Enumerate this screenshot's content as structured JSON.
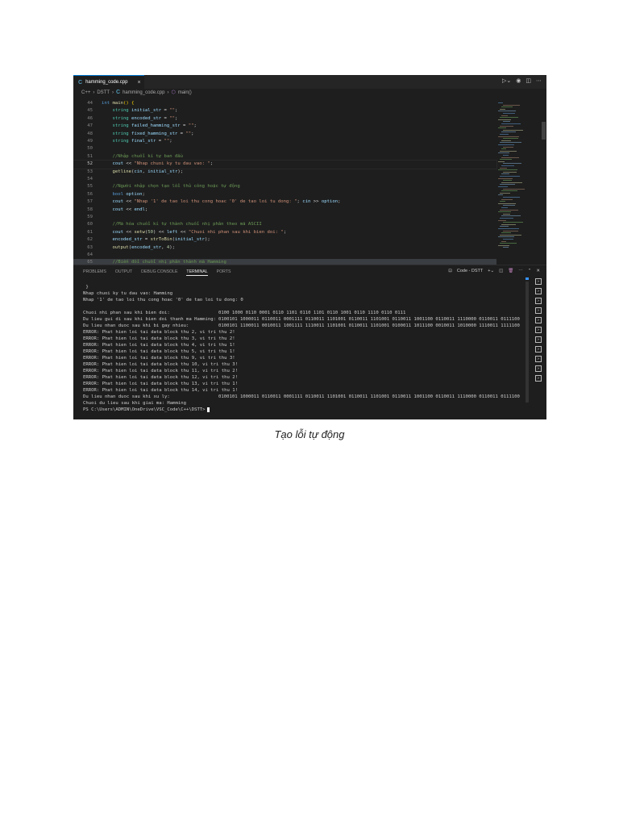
{
  "tab": {
    "icon": "C",
    "filename": "hamming_code.cpp",
    "close": "×"
  },
  "breadcrumb": [
    "C++",
    "DSTT",
    "hamming_code.cpp",
    "main()"
  ],
  "editor_lines": [
    {
      "num": "44",
      "tokens": [
        [
          "int ",
          "k"
        ],
        [
          "main",
          "f"
        ],
        [
          "() {",
          "b"
        ]
      ]
    },
    {
      "num": "45",
      "tokens": [
        [
          "    string ",
          "t"
        ],
        [
          "initial_str",
          "v"
        ],
        [
          " = ",
          "p"
        ],
        [
          "\"\"",
          "s"
        ],
        [
          ";",
          "p"
        ]
      ]
    },
    {
      "num": "46",
      "tokens": [
        [
          "    string ",
          "t"
        ],
        [
          "encoded_str",
          "v"
        ],
        [
          " = ",
          "p"
        ],
        [
          "\"\"",
          "s"
        ],
        [
          ";",
          "p"
        ]
      ]
    },
    {
      "num": "47",
      "tokens": [
        [
          "    string ",
          "t"
        ],
        [
          "failed_hamming_str",
          "v"
        ],
        [
          " = ",
          "p"
        ],
        [
          "\"\"",
          "s"
        ],
        [
          ";",
          "p"
        ]
      ]
    },
    {
      "num": "48",
      "tokens": [
        [
          "    string ",
          "t"
        ],
        [
          "fixed_hamming_str",
          "v"
        ],
        [
          " = ",
          "p"
        ],
        [
          "\"\"",
          "s"
        ],
        [
          ";",
          "p"
        ]
      ]
    },
    {
      "num": "49",
      "tokens": [
        [
          "    string ",
          "t"
        ],
        [
          "final_str",
          "v"
        ],
        [
          " = ",
          "p"
        ],
        [
          "\"\"",
          "s"
        ],
        [
          ";",
          "p"
        ]
      ]
    },
    {
      "num": "50",
      "tokens": []
    },
    {
      "num": "51",
      "tokens": [
        [
          "    //Nhập chuỗi kí tự ban đầu",
          "c"
        ]
      ]
    },
    {
      "num": "52",
      "tokens": [
        [
          "    cout",
          "v"
        ],
        [
          " << ",
          "p"
        ],
        [
          "\"Nhap chuoi ky tu dau vao: \"",
          "s"
        ],
        [
          ";",
          "p"
        ]
      ]
    },
    {
      "num": "53",
      "tokens": [
        [
          "    getline",
          "f"
        ],
        [
          "(",
          "p"
        ],
        [
          "cin",
          "v"
        ],
        [
          ", ",
          "p"
        ],
        [
          "initial_str",
          "v"
        ],
        [
          ");",
          "p"
        ]
      ]
    },
    {
      "num": "54",
      "tokens": []
    },
    {
      "num": "55",
      "tokens": [
        [
          "    //Người nhập chọn tạo lỗi thủ công hoặc tự động",
          "c"
        ]
      ]
    },
    {
      "num": "56",
      "tokens": [
        [
          "    bool ",
          "k"
        ],
        [
          "option",
          "v"
        ],
        [
          ";",
          "p"
        ]
      ]
    },
    {
      "num": "57",
      "tokens": [
        [
          "    cout",
          "v"
        ],
        [
          " << ",
          "p"
        ],
        [
          "\"Nhap '1' de tao loi thu cong hoac '0' de tao loi tu dong: \"",
          "s"
        ],
        [
          "; ",
          "p"
        ],
        [
          "cin",
          "v"
        ],
        [
          " >> ",
          "p"
        ],
        [
          "option",
          "v"
        ],
        [
          ";",
          "p"
        ]
      ]
    },
    {
      "num": "58",
      "tokens": [
        [
          "    cout",
          "v"
        ],
        [
          " << ",
          "p"
        ],
        [
          "endl",
          "v"
        ],
        [
          ";",
          "p"
        ]
      ]
    },
    {
      "num": "59",
      "tokens": []
    },
    {
      "num": "60",
      "tokens": [
        [
          "    //Mã hóa chuỗi kí tự thành chuỗi nhị phân theo mã ASCII",
          "c"
        ]
      ]
    },
    {
      "num": "61",
      "tokens": [
        [
          "    cout",
          "v"
        ],
        [
          " << ",
          "p"
        ],
        [
          "setw",
          "f"
        ],
        [
          "(",
          "p"
        ],
        [
          "50",
          "n"
        ],
        [
          ") << ",
          "p"
        ],
        [
          "left",
          "v"
        ],
        [
          " << ",
          "p"
        ],
        [
          "\"Chuoi nhi phan sau khi bien doi: \"",
          "s"
        ],
        [
          ";",
          "p"
        ]
      ]
    },
    {
      "num": "62",
      "tokens": [
        [
          "    encoded_str",
          "v"
        ],
        [
          " = ",
          "p"
        ],
        [
          "strToBin",
          "f"
        ],
        [
          "(",
          "p"
        ],
        [
          "initial_str",
          "v"
        ],
        [
          ");",
          "p"
        ]
      ]
    },
    {
      "num": "63",
      "tokens": [
        [
          "    output",
          "f"
        ],
        [
          "(",
          "p"
        ],
        [
          "encoded_str",
          "v"
        ],
        [
          ", ",
          "p"
        ],
        [
          "4",
          "n"
        ],
        [
          ");",
          "p"
        ]
      ]
    },
    {
      "num": "64",
      "tokens": []
    },
    {
      "num": "65",
      "tokens": [
        [
          "    //Biến đổi chuỗi nhị phân thành mã Hamming",
          "c"
        ]
      ]
    }
  ],
  "panel": {
    "tabs": [
      "PROBLEMS",
      "OUTPUT",
      "DEBUG CONSOLE",
      "TERMINAL",
      "PORTS"
    ],
    "active_tab": "TERMINAL",
    "terminal_name": "Code - DSTT"
  },
  "terminal_lines": [
    {
      "label": " }",
      "value": ""
    },
    {
      "label": "Nhap chuoi ky tu dau vao: Hamming",
      "value": ""
    },
    {
      "label": "Nhap '1' de tao loi thu cong hoac '0' de tao loi tu dong: 0",
      "value": ""
    },
    {
      "label": "",
      "value": ""
    },
    {
      "label": "Chuoi nhi phan sau khi bien doi:",
      "value": "0100 1000 0110 0001 0110 1101 0110 1101 0110 1001 0110 1110 0110 0111",
      "col": true
    },
    {
      "label": "Du lieu gui di sau khi bien doi thanh ma Hamming:",
      "value": "0100101 1000011 0110011 0001111 0110011 1101001 0110011 1101001 0110011 1001100 0110011 1110000 0110011 0111100",
      "col": true
    },
    {
      "label": "Du lieu nhan duoc sau khi bi gay nhieu:",
      "value": "0100101 1100011 0010011 1001111 1110011 1101001 0110011 1101001 0100011 1011100 0010011 1010000 1110011 1111100",
      "col": true
    },
    {
      "label": "ERROR: Phat hien loi tai data block thu 2, vi tri thu 2!",
      "value": ""
    },
    {
      "label": "ERROR: Phat hien loi tai data block thu 3, vi tri thu 2!",
      "value": ""
    },
    {
      "label": "ERROR: Phat hien loi tai data block thu 4, vi tri thu 1!",
      "value": ""
    },
    {
      "label": "ERROR: Phat hien loi tai data block thu 5, vi tri thu 1!",
      "value": ""
    },
    {
      "label": "ERROR: Phat hien loi tai data block thu 9, vi tri thu 3!",
      "value": ""
    },
    {
      "label": "ERROR: Phat hien loi tai data block thu 10, vi tri thu 3!",
      "value": ""
    },
    {
      "label": "ERROR: Phat hien loi tai data block thu 11, vi tri thu 2!",
      "value": ""
    },
    {
      "label": "ERROR: Phat hien loi tai data block thu 12, vi tri thu 2!",
      "value": ""
    },
    {
      "label": "ERROR: Phat hien loi tai data block thu 13, vi tri thu 1!",
      "value": ""
    },
    {
      "label": "ERROR: Phat hien loi tai data block thu 14, vi tri thu 1!",
      "value": ""
    },
    {
      "label": "Du lieu nhan duoc sau khi xu ly:",
      "value": "0100101 1000011 0110011 0001111 0110011 1101001 0110011 1101001 0110011 1001100 0110011 1110000 0110011 0111100",
      "col": true
    },
    {
      "label": "Chuoi du lieu sau khi giai ma: Hamming",
      "value": ""
    }
  ],
  "prompt": "PS C:\\Users\\ADMIN\\OneDrive\\VSC_Code\\C++\\DSTT>",
  "caption": "Tạo lỗi tự động"
}
